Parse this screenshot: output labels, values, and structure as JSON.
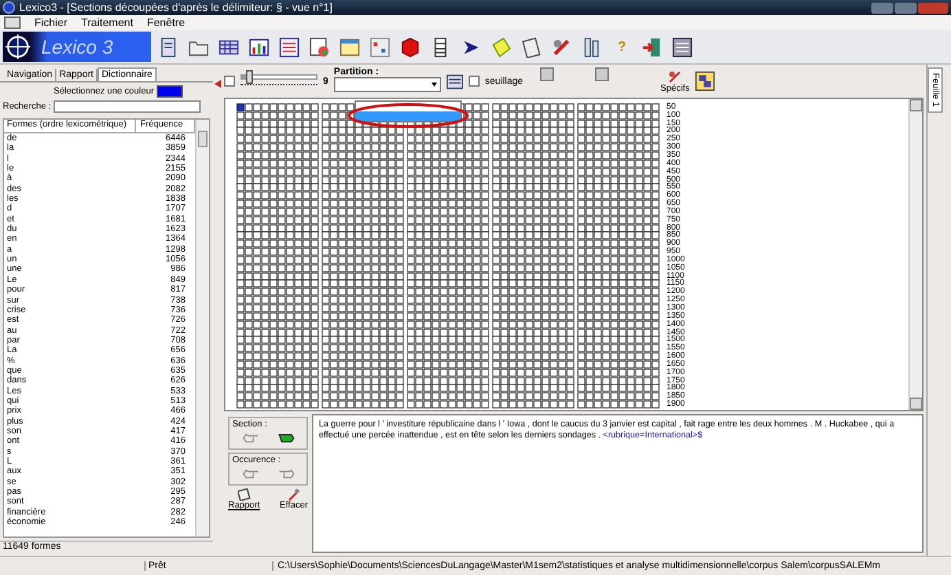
{
  "window": {
    "title": "Lexico3 - [Sections  découpées d'après le délimiteur:  §  - vue n°1]"
  },
  "menu": [
    "Fichier",
    "Traitement",
    "Fenêtre"
  ],
  "toolbar": {
    "logo": "Lexico 3",
    "help_glyph": "?"
  },
  "left_panel": {
    "tabs": [
      {
        "label": "Navigation",
        "selected": false
      },
      {
        "label": "Rapport",
        "selected": false
      },
      {
        "label": "Dictionnaire",
        "selected": true
      }
    ],
    "color_label": "Sélectionnez une couleur",
    "color": "#0000ee",
    "search_label": "Recherche :",
    "columns": [
      "Formes (ordre lexicométrique)",
      "Fréquence"
    ],
    "rows": [
      [
        "de",
        "6446"
      ],
      [
        "la",
        "3859"
      ],
      [
        "l",
        "2344"
      ],
      [
        "le",
        "2155"
      ],
      [
        "à",
        "2090"
      ],
      [
        "des",
        "2082"
      ],
      [
        "les",
        "1838"
      ],
      [
        "d",
        "1707"
      ],
      [
        "et",
        "1681"
      ],
      [
        "du",
        "1623"
      ],
      [
        "en",
        "1364"
      ],
      [
        "a",
        "1298"
      ],
      [
        "un",
        "1056"
      ],
      [
        "une",
        "986"
      ],
      [
        "Le",
        "849"
      ],
      [
        "pour",
        "817"
      ],
      [
        "sur",
        "738"
      ],
      [
        "crise",
        "736"
      ],
      [
        "est",
        "726"
      ],
      [
        "au",
        "722"
      ],
      [
        "par",
        "708"
      ],
      [
        "La",
        "656"
      ],
      [
        "%",
        "636"
      ],
      [
        "que",
        "635"
      ],
      [
        "dans",
        "626"
      ],
      [
        "Les",
        "533"
      ],
      [
        "qui",
        "513"
      ],
      [
        "prix",
        "466"
      ],
      [
        "plus",
        "424"
      ],
      [
        "son",
        "417"
      ],
      [
        "ont",
        "416"
      ],
      [
        "s",
        "370"
      ],
      [
        "L",
        "361"
      ],
      [
        "aux",
        "351"
      ],
      [
        "se",
        "302"
      ],
      [
        "pas",
        "295"
      ],
      [
        "sont",
        "287"
      ],
      [
        "financière",
        "282"
      ],
      [
        "économie",
        "246"
      ]
    ],
    "count": "11649 formes"
  },
  "controls": {
    "slider_checked": false,
    "slider_value": "9",
    "level": 0.05,
    "partition_label": "Partition :",
    "seuil_label": "seuillage",
    "seuil_checked": false,
    "specifs_label": "Spécifs"
  },
  "grid": {
    "rows": [
      {
        "label": "50",
        "selected": true
      },
      {
        "label": "100",
        "selected": false
      },
      {
        "label": "150",
        "selected": false
      },
      {
        "label": "200",
        "selected": false
      },
      {
        "label": "250",
        "selected": false
      },
      {
        "label": "300",
        "selected": false
      },
      {
        "label": "350",
        "selected": false
      },
      {
        "label": "400",
        "selected": false
      },
      {
        "label": "450",
        "selected": false
      },
      {
        "label": "500",
        "selected": false
      },
      {
        "label": "550",
        "selected": false
      },
      {
        "label": "600",
        "selected": false
      },
      {
        "label": "650",
        "selected": false
      },
      {
        "label": "700",
        "selected": false
      },
      {
        "label": "750",
        "selected": false
      },
      {
        "label": "800",
        "selected": false
      },
      {
        "label": "850",
        "selected": false
      },
      {
        "label": "900",
        "selected": false
      },
      {
        "label": "950",
        "selected": false
      },
      {
        "label": "1000",
        "selected": false
      },
      {
        "label": "1050",
        "selected": false
      },
      {
        "label": "1100",
        "selected": false
      },
      {
        "label": "1150",
        "selected": false
      },
      {
        "label": "1200",
        "selected": false
      },
      {
        "label": "1250",
        "selected": false
      },
      {
        "label": "1300",
        "selected": false
      },
      {
        "label": "1350",
        "selected": false
      },
      {
        "label": "1400",
        "selected": false
      },
      {
        "label": "1450",
        "selected": false
      },
      {
        "label": "1500",
        "selected": false
      },
      {
        "label": "1550",
        "selected": false
      },
      {
        "label": "1600",
        "selected": false
      },
      {
        "label": "1650",
        "selected": false
      },
      {
        "label": "1700",
        "selected": false
      },
      {
        "label": "1750",
        "selected": false
      },
      {
        "label": "1800",
        "selected": false
      },
      {
        "label": "1850",
        "selected": false
      },
      {
        "label": "1900",
        "selected": false
      }
    ],
    "dropdown_items": [
      {
        "selected": false
      },
      {
        "selected": true
      }
    ]
  },
  "bottom": {
    "section_label": "Section :",
    "occurrence_label": "Occurence :",
    "rapport": "Rapport",
    "effacer": "Effacer",
    "text": "La guerre pour l ' investiture républicaine dans l ' Iowa , dont le caucus du 3 janvier est capital , fait rage entre les deux hommes . M . Huckabee , qui a effectué une percée inattendue , est en tête selon les derniers sondages .",
    "link": "<rubrique=International>$"
  },
  "side_tab": "Feuille 1",
  "status": {
    "state": "Prêt",
    "path": "C:\\Users\\Sophie\\Documents\\SciencesDuLangage\\Master\\M1sem2\\statistiques et analyse multidimensionnelle\\corpus Salem\\corpusSALEMm"
  }
}
